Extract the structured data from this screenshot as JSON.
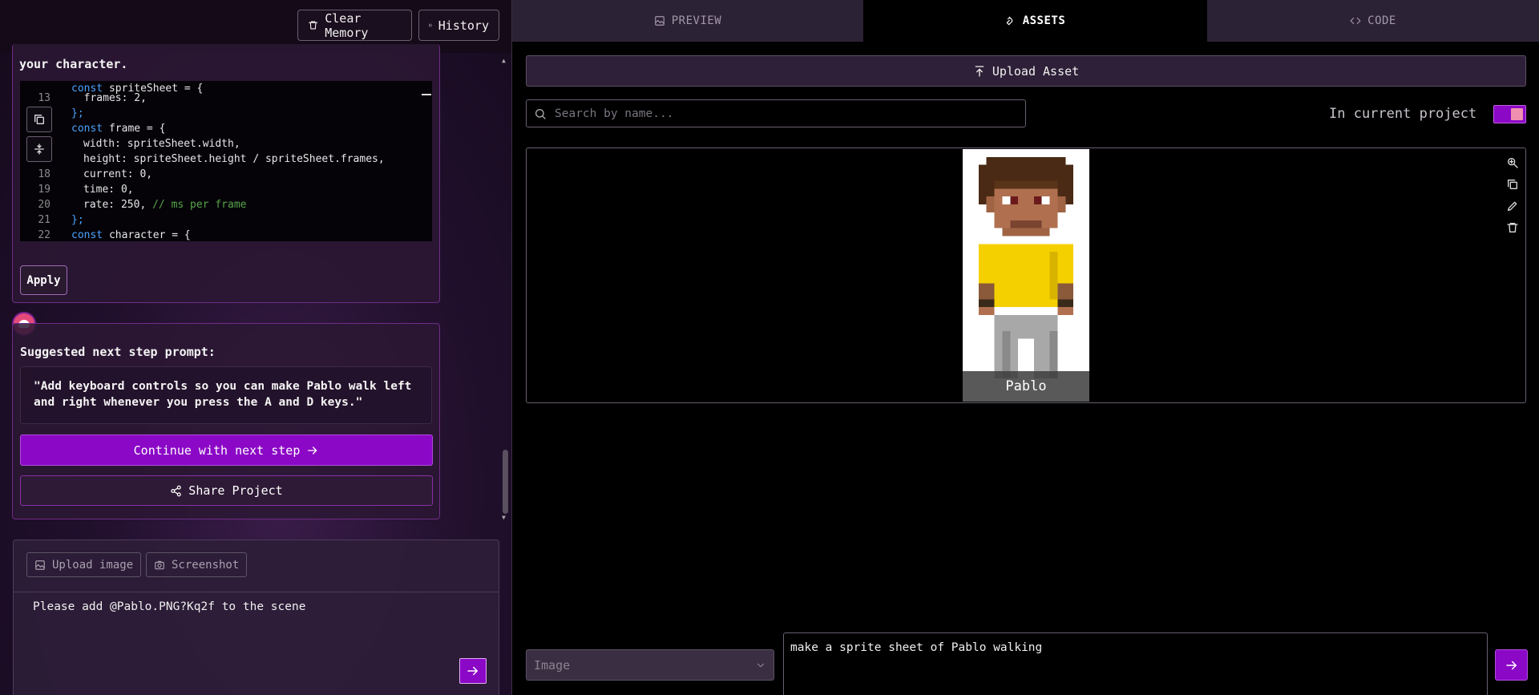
{
  "header": {
    "clear_memory_label": "Clear Memory",
    "history_label": "History"
  },
  "chat": {
    "intro_text_tail": "your character.",
    "code_lines": [
      {
        "num": "13",
        "text": "frames: 2,"
      },
      {
        "num": "",
        "text": "};"
      },
      {
        "num": "",
        "text": "const frame = {"
      },
      {
        "num": "",
        "text": "width: spriteSheet.width,"
      },
      {
        "num": "",
        "text": "height: spriteSheet.height / spriteSheet.frames,"
      },
      {
        "num": "18",
        "text": "current: 0,"
      },
      {
        "num": "19",
        "text": "time: 0,"
      },
      {
        "num": "20",
        "text": "rate: 250, // ms per frame"
      },
      {
        "num": "21",
        "text": "};"
      },
      {
        "num": "22",
        "text": "const character = {"
      }
    ],
    "code_first_line": "const spriteSheet = {",
    "apply_label": "Apply",
    "suggest_heading": "Suggested next step prompt:",
    "suggest_prompt": "\"Add keyboard controls so you can make Pablo walk left and right whenever you press the A and D keys.\"",
    "continue_label": "Continue with next step",
    "share_label": "Share Project"
  },
  "composer": {
    "upload_image_label": "Upload image",
    "screenshot_label": "Screenshot",
    "message": "Please add @Pablo.PNG?Kq2f to the scene"
  },
  "tabs": [
    {
      "label": "PREVIEW",
      "active": false
    },
    {
      "label": "ASSETS",
      "active": true
    },
    {
      "label": "CODE",
      "active": false
    }
  ],
  "assets": {
    "upload_label": "Upload Asset",
    "search_placeholder": "Search by name...",
    "filter_label": "In current project",
    "filter_on": true,
    "items": [
      {
        "name": "Pablo"
      }
    ]
  },
  "generator": {
    "type_selected": "Image",
    "prompt": "make a sprite sheet of Pablo walking"
  },
  "colors": {
    "accent": "#8b08c6",
    "card_border": "#6e2c86",
    "toggle_knob": "#f08fb0"
  }
}
